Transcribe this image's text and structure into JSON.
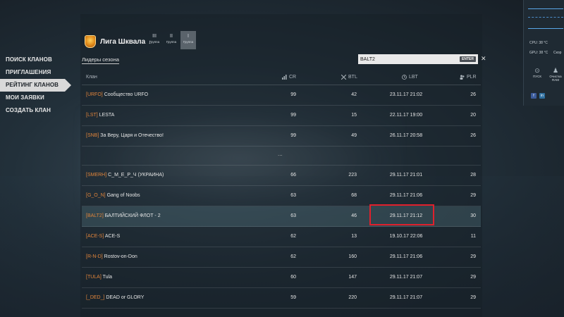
{
  "nav": {
    "items": [
      {
        "label": "ПОИСК КЛАНОВ",
        "active": false
      },
      {
        "label": "ПРИГЛАШЕНИЯ",
        "active": false
      },
      {
        "label": "РЕЙТИНГ КЛАНОВ",
        "active": true
      },
      {
        "label": "МОИ ЗАЯВКИ",
        "active": false
      },
      {
        "label": "СОЗДАТЬ КЛАН",
        "active": false
      }
    ]
  },
  "league": {
    "name": "Лига Шквала",
    "arrow": "↓",
    "icon": "league-shield-icon",
    "groups": [
      {
        "num": "III",
        "label": "Группа",
        "active": false
      },
      {
        "num": "II",
        "label": "Группа",
        "active": false
      },
      {
        "num": "I",
        "label": "Группа",
        "active": true
      }
    ]
  },
  "tabs": {
    "leaders": "Лидеры сезона"
  },
  "search": {
    "value": "BALT2",
    "enter": "ENTER",
    "close": "✕"
  },
  "table": {
    "headers": {
      "clan": "Клан",
      "cr": "CR",
      "btl": "BTL",
      "lbt": "LBT",
      "plr": "PLR"
    },
    "top_rows": [
      {
        "tag": "[URFO]",
        "name": "Сообщество URFO",
        "cr": "99",
        "btl": "42",
        "lbt": "23.11.17 21:02",
        "plr": "26"
      },
      {
        "tag": "[LST]",
        "name": "LESTA",
        "cr": "99",
        "btl": "15",
        "lbt": "22.11.17 19:00",
        "plr": "20"
      },
      {
        "tag": "[SNB]",
        "name": "За Веру, Царя и Отечество!",
        "cr": "99",
        "btl": "49",
        "lbt": "26.11.17 20:58",
        "plr": "26"
      }
    ],
    "ellipsis": "...",
    "rows": [
      {
        "tag": "[SMERH]",
        "name": "С_М_Е_Р_Ч (УКРАИНА)",
        "cr": "66",
        "btl": "223",
        "lbt": "29.11.17 21:01",
        "plr": "28",
        "highlight": false
      },
      {
        "tag": "[G_O_N]",
        "name": "Gang of Noobs",
        "cr": "63",
        "btl": "68",
        "lbt": "29.11.17 21:06",
        "plr": "29",
        "highlight": false
      },
      {
        "tag": "[BALT2]",
        "name": "БАЛТИЙСКИЙ ФЛОТ - 2",
        "cr": "63",
        "btl": "46",
        "lbt": "29.11.17 21:12",
        "plr": "30",
        "highlight": true
      },
      {
        "tag": "[ACE-S]",
        "name": "ACE-S",
        "cr": "62",
        "btl": "13",
        "lbt": "19.10.17 22:06",
        "plr": "11",
        "highlight": false
      },
      {
        "tag": "[R-N-D]",
        "name": "Rostov-on-Don",
        "cr": "62",
        "btl": "160",
        "lbt": "29.11.17 21:06",
        "plr": "29",
        "highlight": false
      },
      {
        "tag": "[TULA]",
        "name": "Tula",
        "cr": "60",
        "btl": "147",
        "lbt": "29.11.17 21:07",
        "plr": "29",
        "highlight": false
      },
      {
        "tag": "[_DED_]",
        "name": "DEAD or GLORY",
        "cr": "59",
        "btl": "220",
        "lbt": "29.11.17 21:07",
        "plr": "29",
        "highlight": false
      }
    ]
  },
  "widget": {
    "cpu": "CPU: 38 °C",
    "gpu": "GPU: 38 °C",
    "gpu_extra": "Скор",
    "buttons": [
      {
        "label": "ПУСК",
        "icon": "search-icon"
      },
      {
        "label": "Очистка RAM",
        "icon": "broom-icon"
      }
    ],
    "social": [
      "f",
      "in"
    ]
  },
  "colors": {
    "clan_tag": "#e0843a",
    "highlight_box": "#e0202c",
    "accent_blue": "#5aa7e8"
  }
}
